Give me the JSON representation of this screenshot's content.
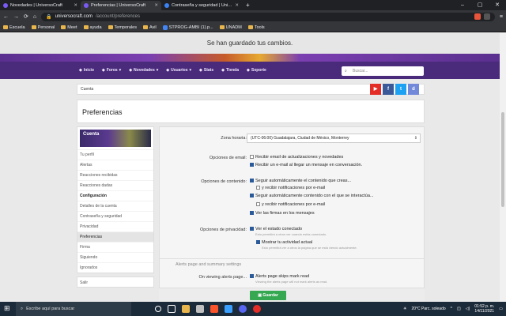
{
  "browser": {
    "tabs": [
      {
        "title": "Novedades | UniversoCraft",
        "active": false
      },
      {
        "title": "Preferencias | UniversoCraft",
        "active": true
      },
      {
        "title": "Contraseña y seguridad | UniversoC...",
        "active": false
      }
    ],
    "url_host": "universocraft.com",
    "url_path": "/account/preferences",
    "bookmarks": [
      "Escuela",
      "Personal",
      "Meet",
      "ayuda",
      "Temporales",
      "Avil",
      "STPROG-AMBI (1).p...",
      "UNADM",
      "Tools"
    ]
  },
  "notice": "Se han guardado tus cambios.",
  "nav": {
    "items": [
      "Inicio",
      "Foros",
      "Novedades",
      "Usuarios",
      "Stats",
      "Tienda",
      "Soporte"
    ],
    "search_placeholder": "Buscar..."
  },
  "breadcrumb": "Cuenta",
  "page_title": "Preferencias",
  "sidebar": {
    "header": "Cuenta",
    "items": [
      {
        "label": "Tu perfil",
        "type": "link"
      },
      {
        "label": "Alertas",
        "type": "link"
      },
      {
        "label": "Reacciones recibidas",
        "type": "link"
      },
      {
        "label": "Reacciones dadas",
        "type": "link"
      },
      {
        "label": "Configuración",
        "type": "section"
      },
      {
        "label": "Detalles de la cuenta",
        "type": "link"
      },
      {
        "label": "Contraseña y seguridad",
        "type": "link"
      },
      {
        "label": "Privacidad",
        "type": "link"
      },
      {
        "label": "Preferencias",
        "type": "selected"
      },
      {
        "label": "Firma",
        "type": "link"
      },
      {
        "label": "Siguiendo",
        "type": "link"
      },
      {
        "label": "Ignorados",
        "type": "link"
      }
    ],
    "logout": "Salir"
  },
  "form": {
    "timezone_label": "Zona horaria:",
    "timezone_value": "(UTC-06:00) Guadalajara, Ciudad de México, Monterrey",
    "email_label": "Opciones de email:",
    "email_opts": [
      {
        "label": "Recibir email de actualizaciones y novedades",
        "checked": false
      },
      {
        "label": "Recibir un e-mail al llegar un mensaje en conversación.",
        "checked": true
      }
    ],
    "content_label": "Opciones de contenido:",
    "content_opts": [
      {
        "label": "Seguir automáticamente el contenido que creas...",
        "checked": true,
        "indent": false
      },
      {
        "label": "y recibir notificaciones por e-mail",
        "checked": false,
        "indent": true
      },
      {
        "label": "Seguir automáticamente contenido con el que se interactúa...",
        "checked": true,
        "indent": false
      },
      {
        "label": "y recibir notificaciones por e-mail",
        "checked": false,
        "indent": true
      },
      {
        "label": "Ver las firmas en los mensajes",
        "checked": true,
        "indent": false
      }
    ],
    "privacy_label": "Opciones de privacidad:",
    "privacy_opts": [
      {
        "label": "Ver el estado conectado",
        "hint": "Esto permitirá a otros ver cuando estás conectado.",
        "checked": true
      },
      {
        "label": "Mostrar tu actividad actual",
        "hint": "Esto permitirá ver a otros la página que se está viendo actualmente.",
        "checked": true
      }
    ],
    "alerts_section": "Alerts page and summary settings",
    "alerts_label": "On viewing alerts page...",
    "alerts_opt": {
      "label": "Alerts page skips mark read",
      "hint": "Viewing the alerts page will not mark alerts as read.",
      "checked": true
    },
    "save_label": "Guardar"
  },
  "taskbar": {
    "search_placeholder": "Escribe aquí para buscar",
    "weather": "20°C  Parc. soleado",
    "time": "01:52 p. m.",
    "date": "14/11/2021"
  }
}
